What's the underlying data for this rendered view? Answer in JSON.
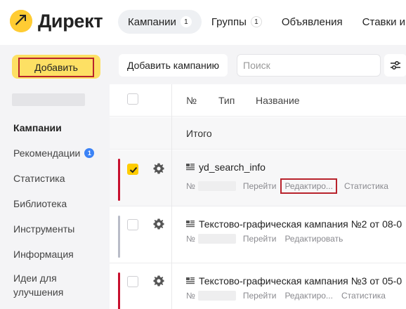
{
  "brand": {
    "name": "Директ",
    "logo_icon": "yandex-direct-logo-icon",
    "logo_color": "#ffcc33"
  },
  "header": {
    "tabs": [
      {
        "label": "Кампании",
        "count": "1",
        "active": true
      },
      {
        "label": "Группы",
        "count": "1",
        "active": false
      },
      {
        "label": "Объявления",
        "count": "",
        "active": false
      },
      {
        "label": "Ставки и",
        "count": "",
        "active": false
      }
    ]
  },
  "sidebar": {
    "add_button": "Добавить",
    "items": [
      {
        "label": "Кампании",
        "active": true
      },
      {
        "label": "Рекомендации",
        "badge": "1"
      },
      {
        "label": "Статистика"
      },
      {
        "label": "Библиотека"
      },
      {
        "label": "Инструменты"
      },
      {
        "label": "Информация"
      },
      {
        "label": "Идеи для улучшения"
      }
    ]
  },
  "toolbar": {
    "add_campaign": "Добавить кампанию",
    "search_placeholder": "Поиск",
    "filter_icon": "filter-sliders-icon"
  },
  "table": {
    "columns": [
      "№",
      "Тип",
      "Название"
    ],
    "total_label": "Итого",
    "rows": [
      {
        "title": "yd_search_info",
        "no_label": "№",
        "actions": [
          "Перейти",
          "Редактиро...",
          "Статистика"
        ],
        "checked": true,
        "stripe_color": "#c8102e"
      },
      {
        "title": "Текстово-графическая кампания №2 от 08-0",
        "no_label": "№",
        "actions": [
          "Перейти",
          "Редактировать"
        ],
        "checked": false,
        "stripe_color": "#b9bcc8"
      },
      {
        "title": "Текстово-графическая кампания №3 от 05-0",
        "no_label": "№",
        "actions": [
          "Перейти",
          "Редактиро...",
          "Статистика"
        ],
        "checked": false,
        "stripe_color": "#c8102e"
      }
    ]
  },
  "colors": {
    "accent_yellow": "#fde064",
    "highlight_red": "#b8232c",
    "checkbox_on": "#ffcc00"
  }
}
